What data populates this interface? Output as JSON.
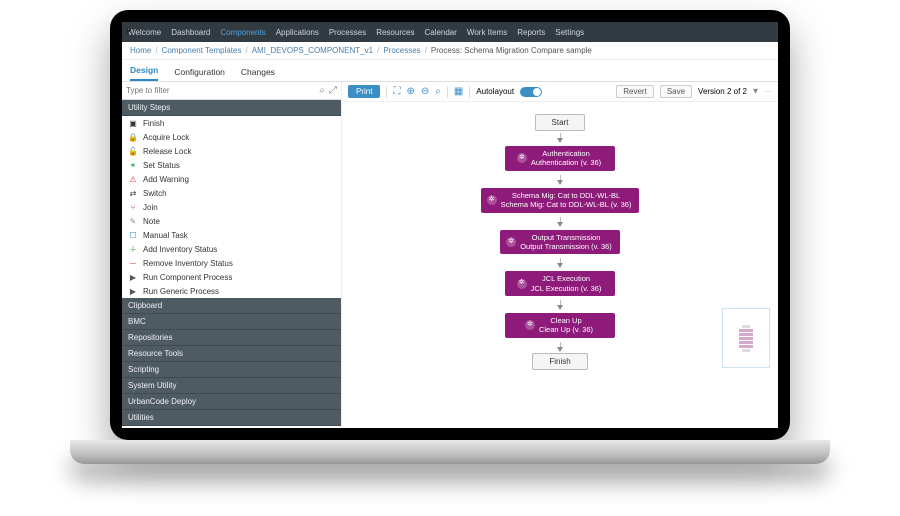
{
  "topnav": {
    "items": [
      "Welcome",
      "Dashboard",
      "Components",
      "Applications",
      "Processes",
      "Resources",
      "Calendar",
      "Work Items",
      "Reports",
      "Settings"
    ],
    "active_index": 2
  },
  "breadcrumb": {
    "parts": [
      "Home",
      "Component Templates",
      "AMI_DEVOPS_COMPONENT_v1",
      "Processes"
    ],
    "current": "Process: Schema Migration Compare sample"
  },
  "tabs": {
    "items": [
      "Design",
      "Configuration",
      "Changes"
    ],
    "active_index": 0
  },
  "filter": {
    "placeholder": "Type to filter"
  },
  "sidebar": {
    "open_category": "Utility Steps",
    "steps": [
      {
        "label": "Finish",
        "icon": "▣",
        "color": "#333"
      },
      {
        "label": "Acquire Lock",
        "icon": "🔒",
        "color": "#d8a000"
      },
      {
        "label": "Release Lock",
        "icon": "🔓",
        "color": "#d8a000"
      },
      {
        "label": "Set Status",
        "icon": "✶",
        "color": "#2aa84a"
      },
      {
        "label": "Add Warning",
        "icon": "⚠",
        "color": "#d83a2a"
      },
      {
        "label": "Switch",
        "icon": "⇄",
        "color": "#333"
      },
      {
        "label": "Join",
        "icon": "⑂",
        "color": "#c43aa0"
      },
      {
        "label": "Note",
        "icon": "✎",
        "color": "#888"
      },
      {
        "label": "Manual Task",
        "icon": "☐",
        "color": "#3a87c4"
      },
      {
        "label": "Add Inventory Status",
        "icon": "＋",
        "color": "#2aa84a"
      },
      {
        "label": "Remove Inventory Status",
        "icon": "－",
        "color": "#d83a2a"
      },
      {
        "label": "Run Component Process",
        "icon": "▶",
        "color": "#555"
      },
      {
        "label": "Run Generic Process",
        "icon": "▶",
        "color": "#555"
      }
    ],
    "categories": [
      "Clipboard",
      "BMC",
      "Repositories",
      "Resource Tools",
      "Scripting",
      "System Utility",
      "UrbanCode Deploy",
      "Utilities"
    ]
  },
  "toolbar": {
    "print": "Print",
    "autolayout_label": "Autolayout",
    "revert": "Revert",
    "save": "Save",
    "version": "Version 2 of 2"
  },
  "flow": {
    "start": "Start",
    "finish": "Finish",
    "nodes": [
      {
        "title": "Authentication",
        "sub": "Authentication (v. 36)"
      },
      {
        "title": "Schema Mig: Cat to DDL-WL-BL",
        "sub": "Schema Mig: Cat to DDL-WL-BL (v. 36)"
      },
      {
        "title": "Output Transmission",
        "sub": "Output Transmission (v. 36)"
      },
      {
        "title": "JCL Execution",
        "sub": "JCL Execution (v. 36)"
      },
      {
        "title": "Clean Up",
        "sub": "Clean Up (v. 36)"
      }
    ]
  }
}
